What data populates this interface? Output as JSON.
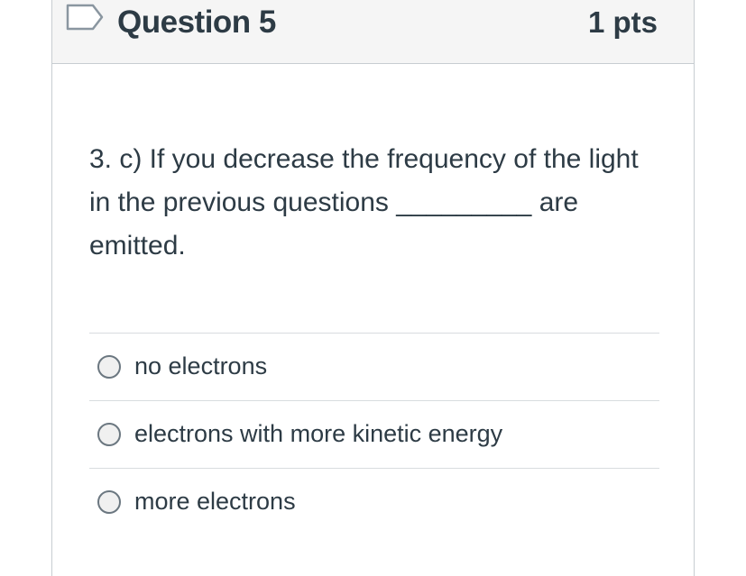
{
  "question": {
    "title": "Question 5",
    "points": "1 pts",
    "text": "3. c) If you decrease the frequency of the light in the previous questions _________ are emitted."
  },
  "answers": [
    {
      "label": "no electrons"
    },
    {
      "label": "electrons with more kinetic energy"
    },
    {
      "label": "more electrons"
    }
  ],
  "colors": {
    "text": "#2d3b45",
    "header_bg": "#f5f5f5",
    "border": "#c7cdd1",
    "flag": "#6b7780"
  },
  "icons": {
    "flag": "flag-question-icon"
  }
}
